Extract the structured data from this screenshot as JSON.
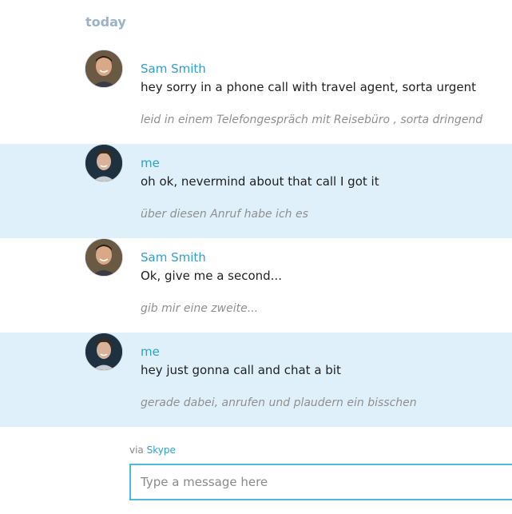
{
  "chat": {
    "day_header": "today",
    "messages": [
      {
        "sender": "Sam Smith",
        "text": "hey sorry in a phone call with travel agent, sorta urgent",
        "translation": "leid in einem Telefongespräch mit Reisebüro , sorta dringend",
        "own": false
      },
      {
        "sender": "me",
        "text": "oh ok, nevermind about that call I got it",
        "translation": "über diesen Anruf habe ich es",
        "own": true
      },
      {
        "sender": "Sam Smith",
        "text": "Ok, give me a second...",
        "translation": "gib mir eine zweite...",
        "own": false
      },
      {
        "sender": "me",
        "text": "hey just gonna call and chat a bit",
        "translation": "gerade dabei, anrufen und plaudern ein bisschen",
        "own": true
      }
    ]
  },
  "footer": {
    "via_label": "via",
    "via_link": "Skype"
  },
  "composer": {
    "placeholder": "Type a message here",
    "value": ""
  },
  "colors": {
    "accent": "#2ea0cc",
    "own_message_bg": "#dff0fa",
    "day_header": "#9ab3c9",
    "translation_text": "#8f8f8f"
  },
  "icons": {
    "sam_avatar": "user-avatar-photo",
    "me_avatar": "user-avatar-photo"
  }
}
